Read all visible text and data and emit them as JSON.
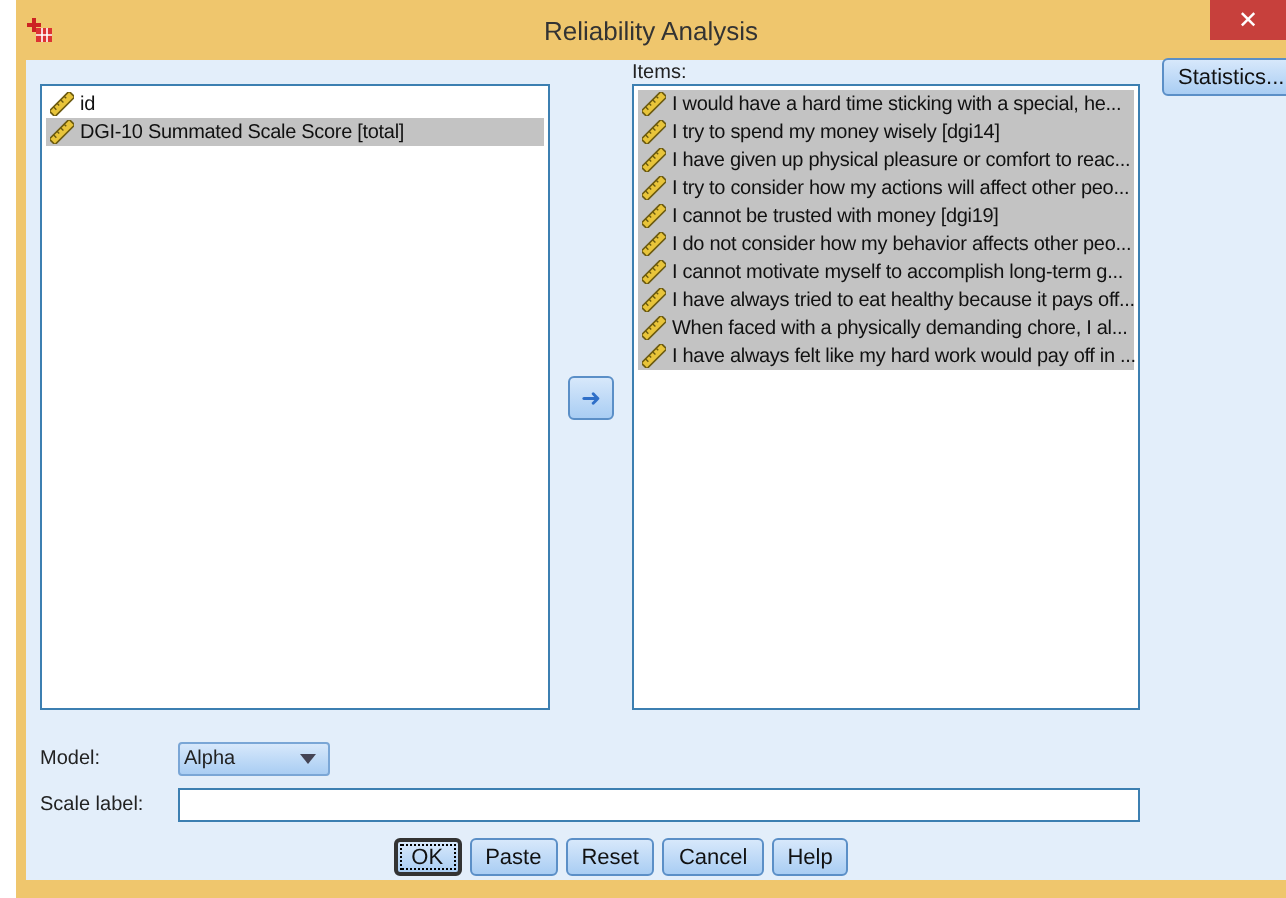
{
  "window": {
    "title": "Reliability Analysis",
    "close": "✕"
  },
  "variables": [
    {
      "label": "id",
      "selected": false
    },
    {
      "label": "DGI-10 Summated Scale Score [total]",
      "selected": true
    }
  ],
  "move_button": "➜",
  "items": {
    "label": "Items:",
    "entries": [
      {
        "label": "I would have a hard time sticking with a special, he...",
        "selected": true
      },
      {
        "label": "I try to spend my money wisely [dgi14]",
        "selected": true
      },
      {
        "label": "I have given up physical pleasure or comfort to reac...",
        "selected": true
      },
      {
        "label": "I try to consider how my actions will affect other peo...",
        "selected": true
      },
      {
        "label": "I cannot be trusted with money [dgi19]",
        "selected": true
      },
      {
        "label": "I do not consider how my behavior affects other peo...",
        "selected": true
      },
      {
        "label": "I cannot motivate myself to accomplish long-term g...",
        "selected": true
      },
      {
        "label": "I have always tried to eat healthy because it pays off...",
        "selected": true
      },
      {
        "label": "When faced with a physically demanding chore, I al...",
        "selected": true
      },
      {
        "label": "I have always felt like my hard work would pay off in ...",
        "selected": true
      }
    ]
  },
  "statistics_button": "Statistics...",
  "model": {
    "label": "Model:",
    "value": "Alpha"
  },
  "scale_label": {
    "label": "Scale label:"
  },
  "buttons": [
    {
      "label": "OK",
      "focused": true
    },
    {
      "label": "Paste",
      "focused": false
    },
    {
      "label": "Reset",
      "focused": false
    },
    {
      "label": "Cancel",
      "focused": false
    },
    {
      "label": "Help",
      "focused": false
    }
  ]
}
